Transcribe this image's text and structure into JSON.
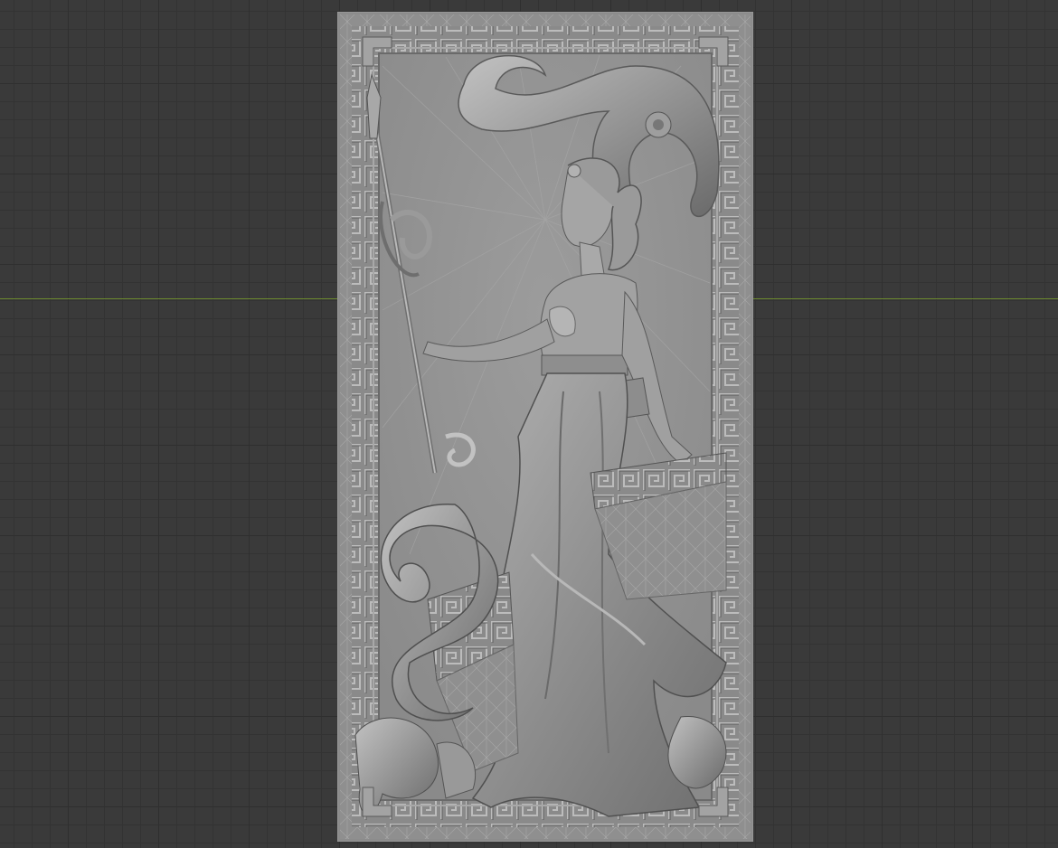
{
  "viewport": {
    "background": "#3a3a3a",
    "grid_minor": "#333333",
    "grid_major": "#2f2f2f",
    "x_axis_color": "#6c8a2e"
  },
  "model": {
    "description_icon": "relief-panel-mesh",
    "base_color": "#8e8e8e",
    "highlight_color": "#b9b9b9",
    "shadow_color": "#5c5c5c"
  }
}
